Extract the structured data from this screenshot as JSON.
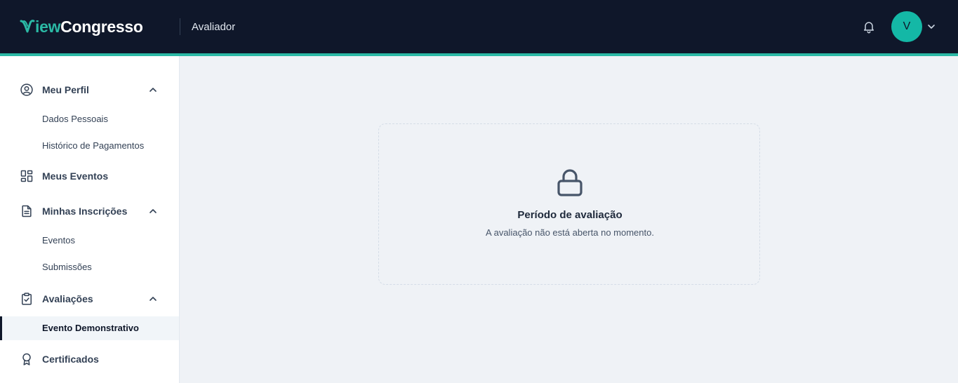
{
  "header": {
    "logo_prefix": "iew",
    "logo_suffix": "Congresso",
    "role": "Avaliador",
    "avatar_initial": "V",
    "accent_color": "#2bb9a5",
    "bg_color": "#0f172a"
  },
  "sidebar": {
    "items": [
      {
        "label": "Meu Perfil",
        "icon": "user-circle-icon",
        "expanded": true
      },
      {
        "label": "Dados Pessoais"
      },
      {
        "label": "Histórico de Pagamentos"
      },
      {
        "label": "Meus Eventos",
        "icon": "grid-icon"
      },
      {
        "label": "Minhas Inscrições",
        "icon": "document-icon",
        "expanded": true
      },
      {
        "label": "Eventos"
      },
      {
        "label": "Submissões"
      },
      {
        "label": "Avaliações",
        "icon": "clipboard-check-icon",
        "expanded": true
      },
      {
        "label": "Evento Demonstrativo",
        "active": true
      },
      {
        "label": "Certificados",
        "icon": "award-icon"
      }
    ]
  },
  "main": {
    "card": {
      "icon": "lock-icon",
      "title": "Período de avaliação",
      "description": "A avaliação não está aberta no momento."
    }
  }
}
